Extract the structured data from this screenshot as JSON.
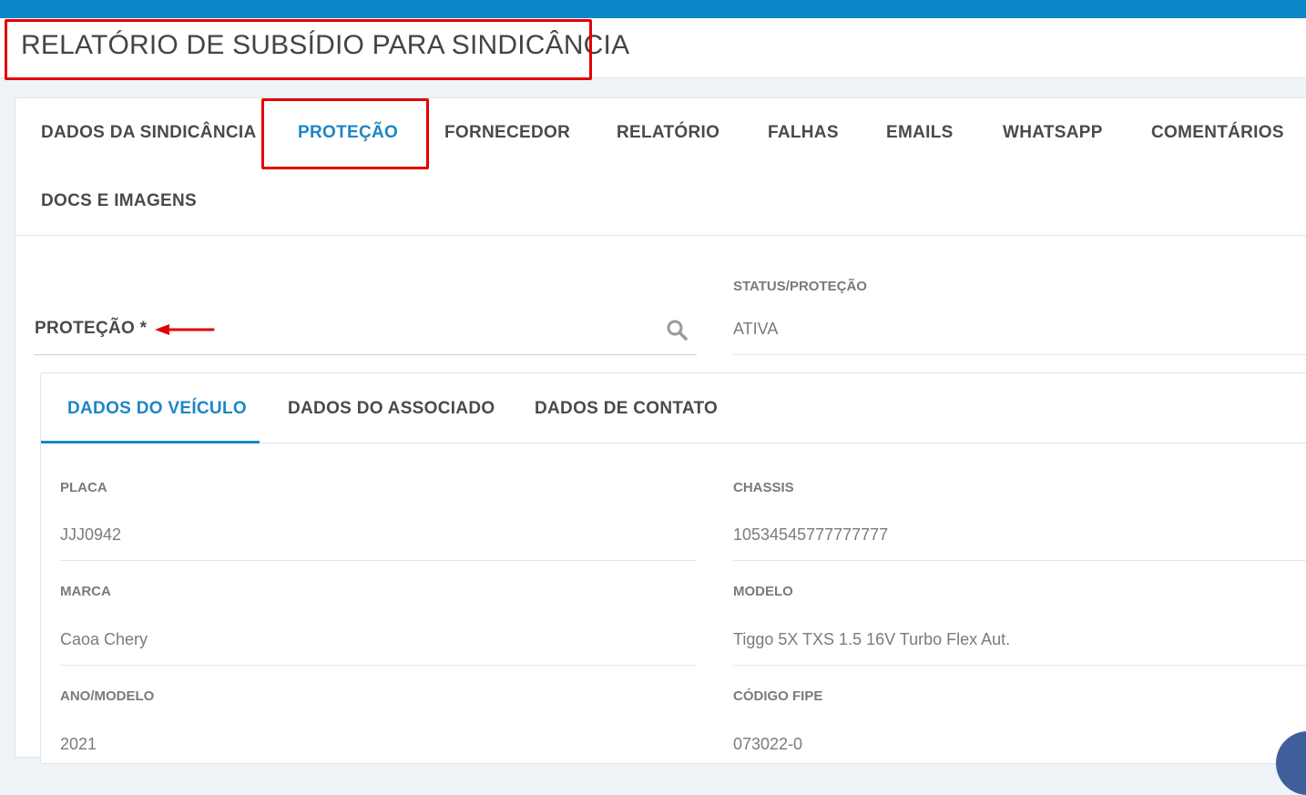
{
  "header": {
    "title": "RELATÓRIO DE SUBSÍDIO PARA SINDICÂNCIA"
  },
  "main_tabs": [
    {
      "label": "DADOS DA SINDICÂNCIA",
      "active": false
    },
    {
      "label": "PROTEÇÃO",
      "active": true
    },
    {
      "label": "FORNECEDOR",
      "active": false
    },
    {
      "label": "RELATÓRIO",
      "active": false
    },
    {
      "label": "FALHAS",
      "active": false
    },
    {
      "label": "EMAILS",
      "active": false
    },
    {
      "label": "WHATSAPP",
      "active": false
    },
    {
      "label": "COMENTÁRIOS",
      "active": false
    },
    {
      "label": "DOCS E IMAGENS",
      "active": false
    }
  ],
  "protection": {
    "label": "PROTEÇÃO *",
    "status_label": "STATUS/PROTEÇÃO",
    "status_value": "ATIVA"
  },
  "inner_tabs": [
    {
      "label": "DADOS DO VEÍCULO",
      "active": true
    },
    {
      "label": "DADOS DO ASSOCIADO",
      "active": false
    },
    {
      "label": "DADOS DE CONTATO",
      "active": false
    }
  ],
  "vehicle": {
    "placa": {
      "label": "PLACA",
      "value": "JJJ0942"
    },
    "chassis": {
      "label": "CHASSIS",
      "value": "10534545777777777"
    },
    "marca": {
      "label": "MARCA",
      "value": "Caoa Chery"
    },
    "modelo": {
      "label": "MODELO",
      "value": "Tiggo 5X TXS 1.5 16V Turbo Flex Aut."
    },
    "ano_modelo": {
      "label": "ANO/MODELO",
      "value": "2021"
    },
    "codigo_fipe": {
      "label": "CÓDIGO FIPE",
      "value": "073022-0"
    }
  },
  "colors": {
    "topbar": "#0a87c9",
    "accent": "#1c86c6",
    "highlight": "#e30000"
  },
  "icons": {
    "search": "search-icon",
    "arrow": "red-arrow-icon"
  }
}
